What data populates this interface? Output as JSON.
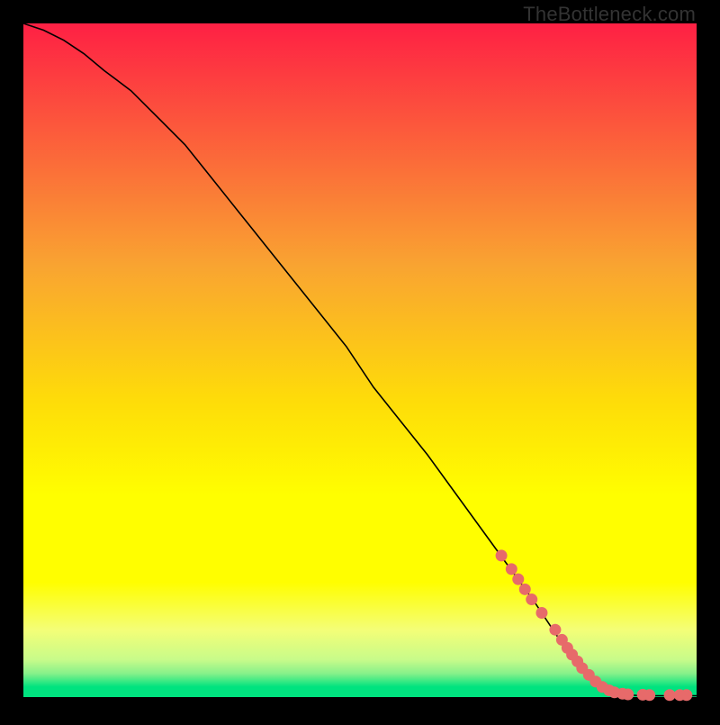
{
  "watermark": "TheBottleneck.com",
  "colors": {
    "bg_top": "#fe2044",
    "bg_mid1": "#f9a432",
    "bg_mid2": "#feed00",
    "bg_mid3": "#f4fe78",
    "bg_bot": "#00e37f",
    "marker": "#e76a6a",
    "line": "#000000"
  },
  "chart_data": {
    "type": "line",
    "title": "",
    "xlabel": "",
    "ylabel": "",
    "xlim": [
      0,
      100
    ],
    "ylim": [
      0,
      100
    ],
    "series": [
      {
        "name": "curve",
        "x": [
          0,
          3,
          6,
          9,
          12,
          16,
          20,
          24,
          28,
          32,
          36,
          40,
          44,
          48,
          52,
          56,
          60,
          64,
          68,
          72,
          76,
          80,
          82,
          84,
          86,
          88,
          90,
          92,
          94,
          96,
          98,
          100
        ],
        "y": [
          100,
          99,
          97.5,
          95.5,
          93,
          90,
          86,
          82,
          77,
          72,
          67,
          62,
          57,
          52,
          46,
          41,
          36,
          30.5,
          25,
          19.5,
          14,
          8,
          5,
          3,
          1.5,
          0.6,
          0.3,
          0.2,
          0.2,
          0.2,
          0.2,
          0.2
        ]
      }
    ],
    "markers": {
      "name": "points",
      "x": [
        71,
        72.5,
        73.5,
        74.5,
        75.5,
        77,
        79,
        80,
        80.8,
        81.5,
        82.3,
        83,
        84,
        85,
        86,
        87,
        87.8,
        89,
        89.8,
        92,
        93,
        96,
        97.5,
        98.5
      ],
      "y": [
        21,
        19,
        17.5,
        16,
        14.5,
        12.5,
        10,
        8.5,
        7.3,
        6.3,
        5.3,
        4.3,
        3.3,
        2.3,
        1.5,
        1,
        0.7,
        0.5,
        0.4,
        0.35,
        0.3,
        0.3,
        0.3,
        0.3
      ]
    }
  }
}
